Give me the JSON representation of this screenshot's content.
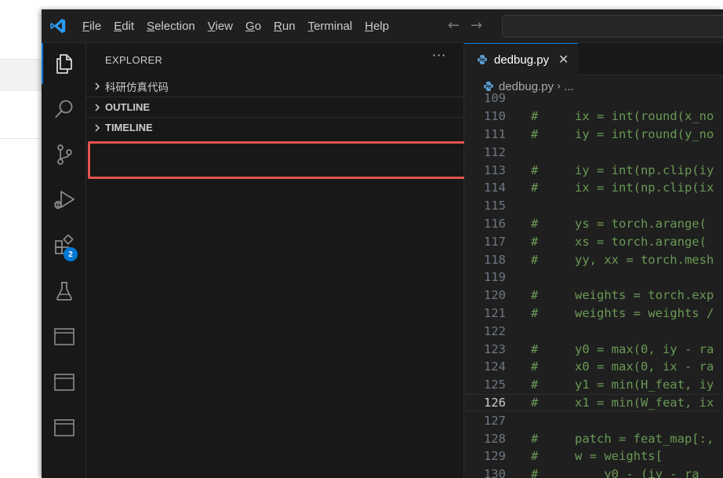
{
  "window": {
    "menu": [
      {
        "label": "File",
        "u": "F",
        "rest": "ile"
      },
      {
        "label": "Edit",
        "u": "E",
        "rest": "dit"
      },
      {
        "label": "Selection",
        "u": "S",
        "rest": "election"
      },
      {
        "label": "View",
        "u": "V",
        "rest": "iew"
      },
      {
        "label": "Go",
        "u": "G",
        "rest": "o"
      },
      {
        "label": "Run",
        "u": "R",
        "rest": "un"
      },
      {
        "label": "Terminal",
        "u": "T",
        "rest": "erminal"
      },
      {
        "label": "Help",
        "u": "H",
        "rest": "elp"
      }
    ],
    "nav_back": "←",
    "nav_forward": "→"
  },
  "activity_bar": {
    "items": [
      {
        "name": "explorer-icon",
        "active": true
      },
      {
        "name": "search-icon"
      },
      {
        "name": "source-control-icon"
      },
      {
        "name": "run-debug-icon"
      },
      {
        "name": "extensions-icon",
        "badge": "2"
      },
      {
        "name": "testing-icon"
      },
      {
        "name": "panel-icon"
      },
      {
        "name": "panel-icon"
      },
      {
        "name": "panel-icon"
      }
    ]
  },
  "sidebar": {
    "title": "EXPLORER",
    "more": "···",
    "sections": [
      {
        "label": "科研仿真代码"
      },
      {
        "label": "OUTLINE"
      },
      {
        "label": "TIMELINE"
      }
    ]
  },
  "editor": {
    "tab": {
      "name": "dedbug.py",
      "close": "✕"
    },
    "breadcrumb": {
      "file": "dedbug.py",
      "sep": "›",
      "more": "..."
    },
    "current_line": 126,
    "lines": [
      {
        "n": "109",
        "t": ""
      },
      {
        "n": "110",
        "t": "#     ix = int(round(x_no"
      },
      {
        "n": "111",
        "t": "#     iy = int(round(y_no"
      },
      {
        "n": "112",
        "t": ""
      },
      {
        "n": "113",
        "t": "#     iy = int(np.clip(iy"
      },
      {
        "n": "114",
        "t": "#     ix = int(np.clip(ix"
      },
      {
        "n": "115",
        "t": ""
      },
      {
        "n": "116",
        "t": "#     ys = torch.arange("
      },
      {
        "n": "117",
        "t": "#     xs = torch.arange("
      },
      {
        "n": "118",
        "t": "#     yy, xx = torch.mesh"
      },
      {
        "n": "119",
        "t": ""
      },
      {
        "n": "120",
        "t": "#     weights = torch.exp"
      },
      {
        "n": "121",
        "t": "#     weights = weights /"
      },
      {
        "n": "122",
        "t": ""
      },
      {
        "n": "123",
        "t": "#     y0 = max(0, iy - ra"
      },
      {
        "n": "124",
        "t": "#     x0 = max(0, ix - ra"
      },
      {
        "n": "125",
        "t": "#     y1 = min(H_feat, iy"
      },
      {
        "n": "126",
        "t": "#     x1 = min(W_feat, ix"
      },
      {
        "n": "127",
        "t": ""
      },
      {
        "n": "128",
        "t": "#     patch = feat_map[:,"
      },
      {
        "n": "129",
        "t": "#     w = weights["
      },
      {
        "n": "130",
        "t": "#         y0 - (iy - ra"
      }
    ]
  },
  "colors": {
    "accent": "#0078d4",
    "comment": "#6a9955",
    "highlight_box": "#e5534b"
  }
}
